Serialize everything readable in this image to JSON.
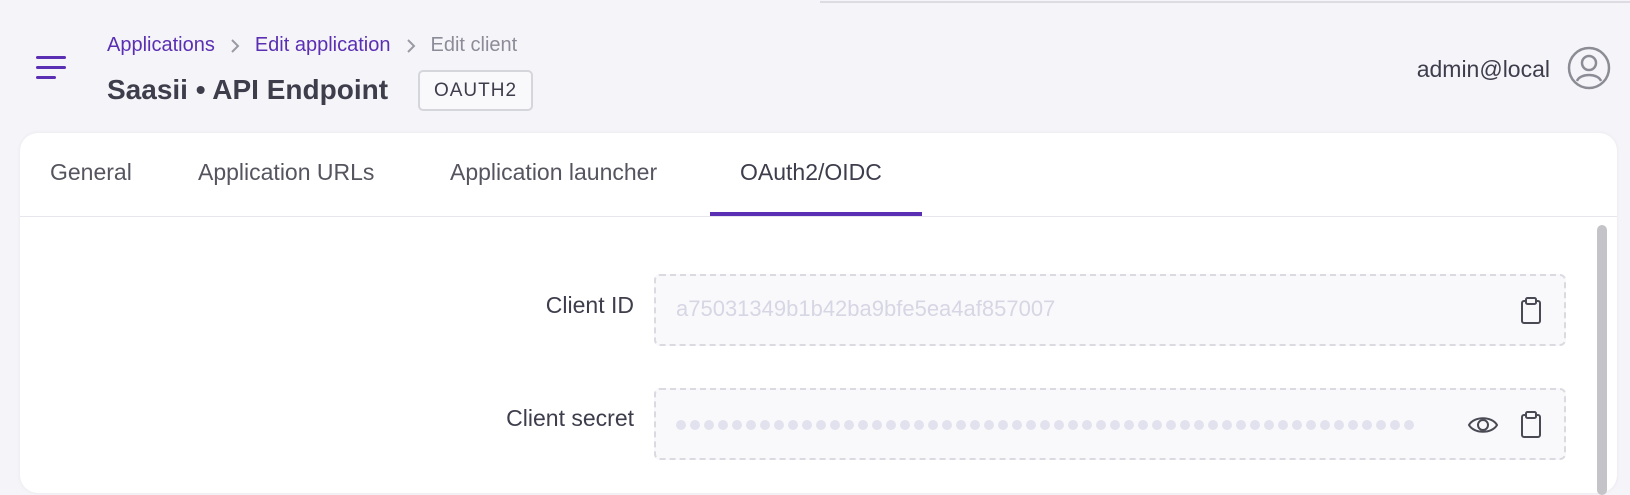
{
  "breadcrumb": {
    "items": [
      "Applications",
      "Edit application"
    ],
    "current": "Edit client"
  },
  "page": {
    "title": "Saasii • API Endpoint",
    "badge": "OAUTH2"
  },
  "user": {
    "name": "admin@local"
  },
  "tabs": [
    {
      "label": "General"
    },
    {
      "label": "Application URLs"
    },
    {
      "label": "Application launcher"
    },
    {
      "label": "OAuth2/OIDC",
      "active": true
    }
  ],
  "fields": {
    "client_id": {
      "label": "Client ID",
      "value": "a75031349b1b42ba9bfe5ea4af857007"
    },
    "client_secret": {
      "label": "Client secret",
      "masked": true
    }
  },
  "colors": {
    "accent": "#5b2fb3",
    "muted_text": "#8c8c99",
    "placeholder_text": "#d6d6e4"
  },
  "icons": {
    "menu": "hamburger-menu-icon",
    "breadcrumb_separator": "chevron-right-icon",
    "avatar": "user-circle-icon",
    "copy": "clipboard-icon",
    "reveal": "eye-icon"
  }
}
